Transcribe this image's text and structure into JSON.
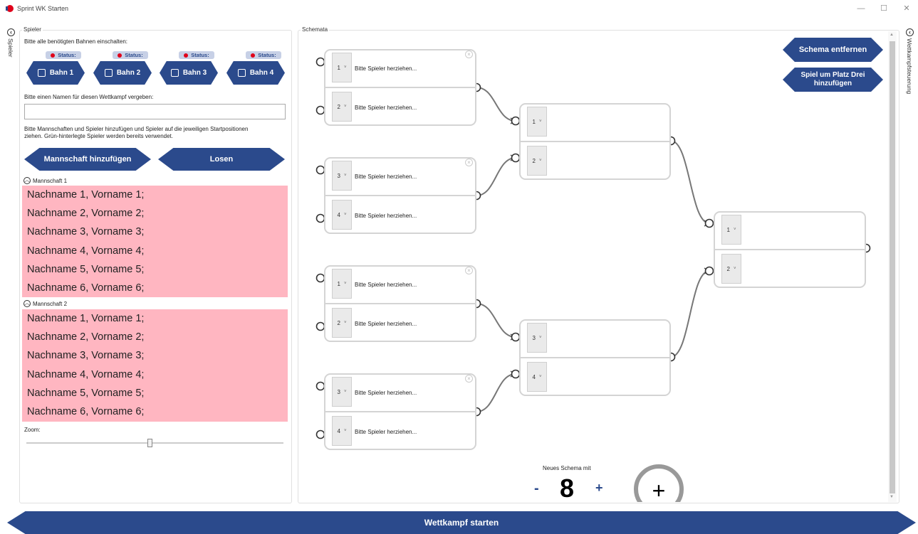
{
  "window": {
    "title": "Sprint WK Starten",
    "minimize": "—",
    "maximize": "☐",
    "close": "✕"
  },
  "side_tabs": {
    "left": "Spieler",
    "right": "Wettkampfsteuerung"
  },
  "spieler": {
    "group_label": "Spieler",
    "bahnen_prompt": "Bitte alle benötigten Bahnen einschalten:",
    "status_label": "Status:",
    "bahnen": [
      {
        "label": "Bahn 1"
      },
      {
        "label": "Bahn 2"
      },
      {
        "label": "Bahn 3"
      },
      {
        "label": "Bahn 4"
      }
    ],
    "name_prompt": "Bitte einen Namen für diesen Wettkampf vergeben:",
    "name_value": "",
    "instructions_line1": "Bitte Mannschaften und Spieler hinzufügen und Spieler auf die jeweiligen Startpositionen",
    "instructions_line2": "ziehen. Grün-hinterlegte Spieler werden bereits verwendet.",
    "add_team_button": "Mannschaft hinzufügen",
    "losen_button": "Losen",
    "teams": [
      {
        "name": "Mannschaft 1",
        "players": [
          "Nachname 1, Vorname 1;",
          "Nachname 2, Vorname 2;",
          "Nachname 3, Vorname 3;",
          "Nachname 4, Vorname 4;",
          "Nachname 5, Vorname 5;",
          "Nachname 6, Vorname 6;"
        ]
      },
      {
        "name": "Mannschaft 2",
        "players": [
          "Nachname 1, Vorname 1;",
          "Nachname 2, Vorname 2;",
          "Nachname 3, Vorname 3;",
          "Nachname 4, Vorname 4;",
          "Nachname 5, Vorname 5;",
          "Nachname 6, Vorname 6;"
        ]
      }
    ],
    "zoom_label": "Zoom:",
    "zoom_level": 0.48
  },
  "schemata": {
    "group_label": "Schemata",
    "remove_button": "Schema entfernen",
    "third_place_button_line1": "Spiel um Platz Drei",
    "third_place_button_line2": "hinzufügen",
    "placeholder": "Bitte Spieler herziehen...",
    "round1": [
      [
        "1",
        "2"
      ],
      [
        "3",
        "4"
      ],
      [
        "1",
        "2"
      ],
      [
        "3",
        "4"
      ]
    ],
    "round2": [
      [
        "1",
        "2"
      ],
      [
        "3",
        "4"
      ]
    ],
    "final": [
      "1",
      "2"
    ],
    "new_schema_label": "Neues Schema mit",
    "new_schema_count": "8",
    "minus": "-",
    "plus": "+",
    "add": "+"
  },
  "start_button": "Wettkampf starten",
  "colors": {
    "accent": "#2b4a8c",
    "team_bg": "#ffb6c1",
    "status_dot": "#e0001a"
  }
}
